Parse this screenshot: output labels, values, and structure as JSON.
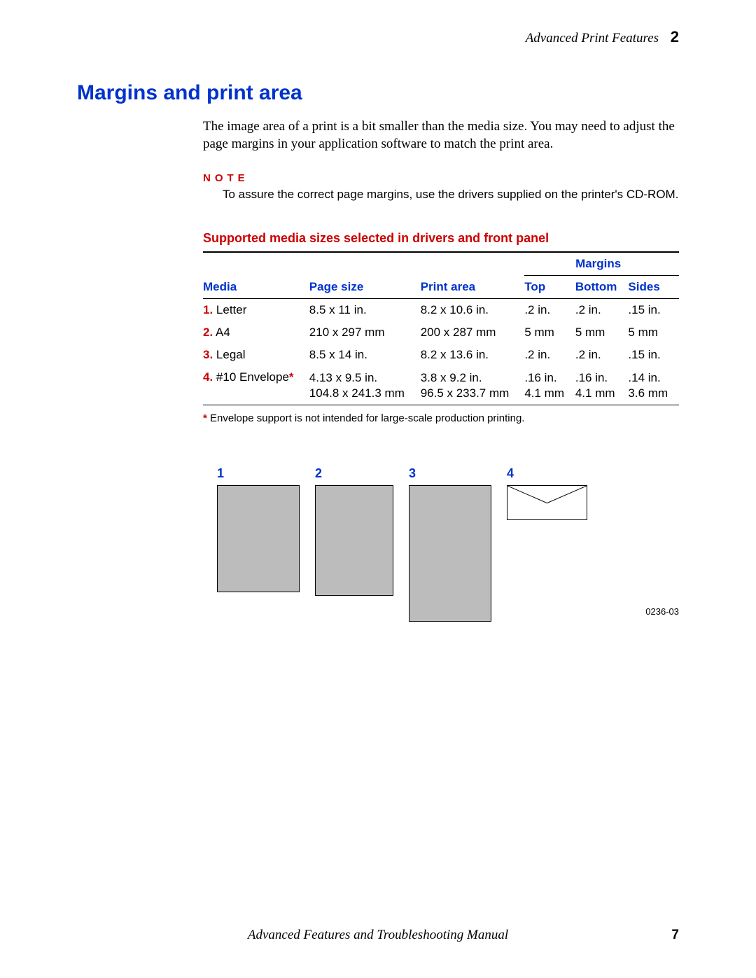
{
  "header": {
    "running_title": "Advanced Print Features",
    "chapter_number": "2"
  },
  "section_title": "Margins and print area",
  "intro": "The image area of a print is a bit smaller than the media size.  You may need to adjust the page margins in your application software to match the print area.",
  "note": {
    "label": "NOTE",
    "text": "To assure the correct page margins, use the drivers supplied on the printer's CD-ROM."
  },
  "caption": "Supported media sizes selected in drivers and front panel",
  "table": {
    "headers": {
      "media": "Media",
      "page_size": "Page size",
      "print_area": "Print area",
      "margins_group": "Margins",
      "top": "Top",
      "bottom": "Bottom",
      "sides": "Sides"
    },
    "rows": [
      {
        "num": "1.",
        "media": "Letter",
        "page_size": "8.5 x 11 in.",
        "print_area": "8.2 x 10.6 in.",
        "top": ".2 in.",
        "bottom": ".2 in.",
        "sides": ".15 in."
      },
      {
        "num": "2.",
        "media": "A4",
        "page_size": "210 x 297 mm",
        "print_area": "200 x 287 mm",
        "top": "5 mm",
        "bottom": "5 mm",
        "sides": "5 mm"
      },
      {
        "num": "3.",
        "media": "Legal",
        "page_size": "8.5 x 14 in.",
        "print_area": "8.2 x 13.6 in.",
        "top": ".2 in.",
        "bottom": ".2 in.",
        "sides": ".15 in."
      },
      {
        "num": "4.",
        "media": "#10 Envelope",
        "star": "*",
        "page_size": "4.13 x 9.5 in.",
        "page_size2": "104.8 x 241.3 mm",
        "print_area": "3.8 x 9.2 in.",
        "print_area2": "96.5 x 233.7 mm",
        "top": ".16 in.",
        "top2": "4.1 mm",
        "bottom": ".16 in.",
        "bottom2": "4.1 mm",
        "sides": ".14 in.",
        "sides2": "3.6 mm"
      }
    ]
  },
  "footnote": {
    "star": "*",
    "text": " Envelope support is not intended for large-scale production printing."
  },
  "diagram": {
    "labels": [
      "1",
      "2",
      "3",
      "4"
    ],
    "figure_ref": "0236-03"
  },
  "footer": {
    "title": "Advanced Features and Troubleshooting Manual",
    "page": "7"
  }
}
